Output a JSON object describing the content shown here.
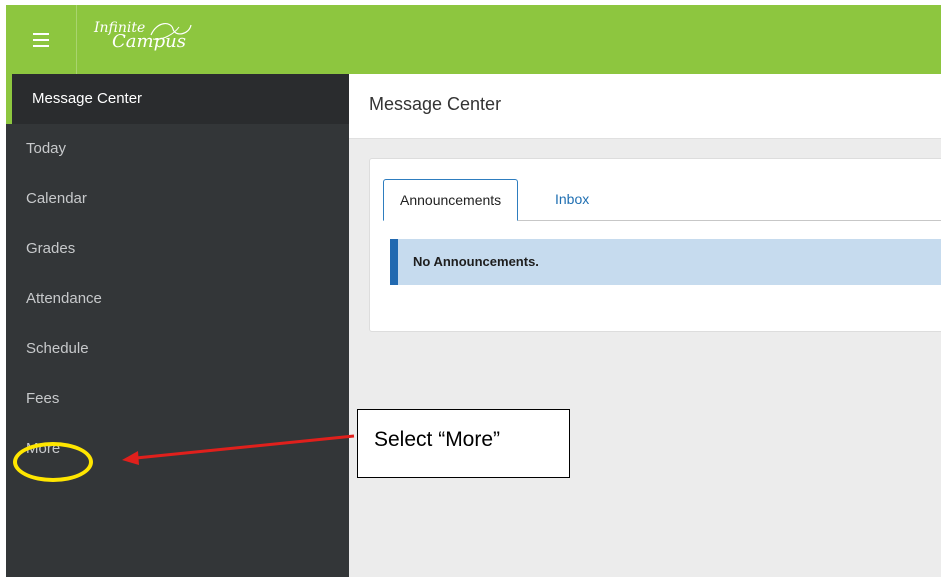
{
  "header": {
    "logo_line1": "Infinite",
    "logo_line2": "Campus",
    "bar_color": "#8dc63f",
    "menu_icon": "hamburger-menu-icon"
  },
  "sidebar": {
    "items": [
      {
        "label": "Message Center",
        "active": true
      },
      {
        "label": "Today"
      },
      {
        "label": "Calendar"
      },
      {
        "label": "Grades"
      },
      {
        "label": "Attendance"
      },
      {
        "label": "Schedule"
      },
      {
        "label": "Fees"
      },
      {
        "label": "More"
      }
    ]
  },
  "main": {
    "page_title": "Message Center",
    "tabs": [
      {
        "label": "Announcements",
        "active": true
      },
      {
        "label": "Inbox"
      }
    ],
    "alert_text": "No Announcements."
  },
  "annotation": {
    "callout_text": "Select “More”",
    "highlight_color": "#ffe600",
    "arrow_color": "#e0201c"
  }
}
